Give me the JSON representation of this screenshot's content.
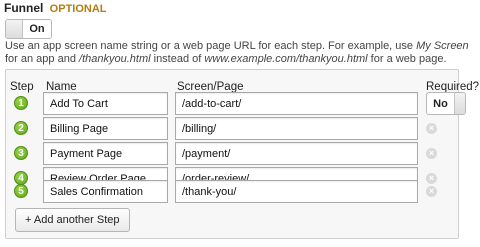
{
  "section": {
    "title": "Funnel",
    "optional_label": "OPTIONAL"
  },
  "toggle": {
    "state_label": "On"
  },
  "help": {
    "text_1": "Use an app screen name string or a web page URL for each step. For example, use ",
    "em_1": "My Screen",
    "text_2": " for an app and ",
    "em_2": "/thankyou.html",
    "text_3": " instead of ",
    "em_3": "www.example.com/thankyou.html",
    "text_4": " for a web page."
  },
  "columns": {
    "step": "Step",
    "name": "Name",
    "screen": "Screen/Page",
    "required": "Required?"
  },
  "steps": [
    {
      "num": "1",
      "name": "Add To Cart",
      "page": "/add-to-cart/"
    },
    {
      "num": "2",
      "name": "Billing Page",
      "page": "/billing/"
    },
    {
      "num": "3",
      "name": "Payment Page",
      "page": "/payment/"
    },
    {
      "num": "4",
      "name": "Review Order Page",
      "page": "/order-review/"
    },
    {
      "num": "5",
      "name": "Sales Confirmation",
      "page": "/thank-you/"
    }
  ],
  "required": {
    "value": "No"
  },
  "add_step_label": "+ Add another Step",
  "remove_glyph": "×",
  "colors": {
    "optional": "#b37d12",
    "step_badge": "#6fb526"
  }
}
